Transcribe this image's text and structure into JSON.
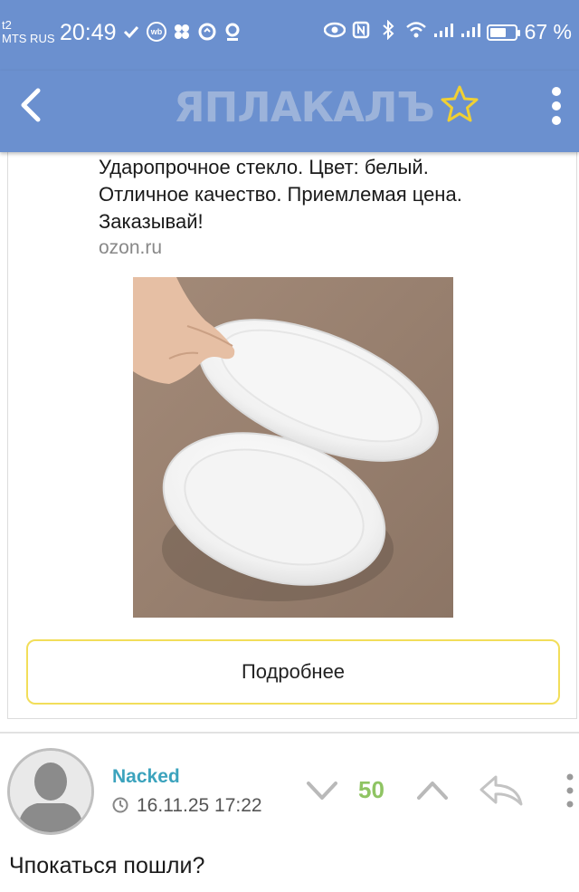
{
  "status_bar": {
    "carrier_line1": "t2",
    "carrier_line2": "MTS RUS",
    "time": "20:49",
    "battery_percent": "67 %",
    "battery_level": 0.67,
    "left_icons": [
      "heart-check-icon",
      "wb-icon",
      "pinwheel-icon",
      "sync-icon",
      "location-pin-icon"
    ],
    "right_icons": [
      "eye-icon",
      "nfc-icon",
      "bluetooth-icon",
      "wifi-icon",
      "signal-icon",
      "signal-icon",
      "battery-icon"
    ],
    "bg_color": "#6b90cf"
  },
  "app_bar": {
    "logo_text": "ЯПЛАКАЛЪ",
    "back_icon": "chevron-left-icon",
    "favorite_icon": "star-outline-icon",
    "menu_icon": "vertical-dots-icon",
    "star_color": "#f0d033"
  },
  "ad": {
    "text_line1": "Ударопрочное стекло. Цвет: белый.",
    "text_line2": "Отличное качество. Приемлемая цена.",
    "text_line3": "Заказывай!",
    "source": "ozon.ru",
    "more_button_label": "Подробнее",
    "button_border_color": "#f2de5a"
  },
  "comment": {
    "author": "Nacked",
    "timestamp": "16.11.25 17:22",
    "score": "50",
    "text": "Чпокаться пошли?",
    "author_color": "#3ca3bd",
    "score_color": "#8fc463"
  }
}
